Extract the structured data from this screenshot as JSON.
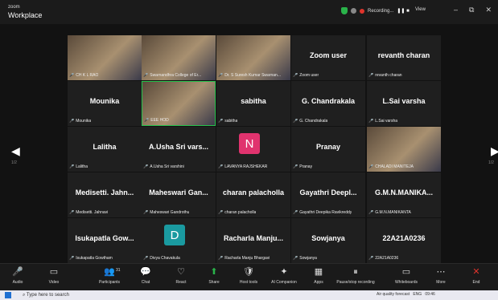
{
  "title": {
    "line1": "zoom",
    "line2": "Workplace"
  },
  "status": {
    "recording": "Recording...",
    "view": "View"
  },
  "window": {
    "min": "–",
    "max": "⧉",
    "close": "✕"
  },
  "nav": {
    "page_left": "1/2",
    "page_right": "1/2"
  },
  "tiles": [
    {
      "name": "",
      "label": "CH K L RAO",
      "video": true
    },
    {
      "name": "",
      "label": "Swarnandhra College of Er...",
      "video": true
    },
    {
      "name": "",
      "label": "Dr. S Suresh Kumar Swarnan...",
      "video": true
    },
    {
      "name": "Zoom user",
      "label": "Zoom user"
    },
    {
      "name": "revanth charan",
      "label": "revanth charan"
    },
    {
      "name": "Mounika",
      "label": "Mounika"
    },
    {
      "name": "",
      "label": "EEE HOD",
      "video": true,
      "active": true
    },
    {
      "name": "sabitha",
      "label": "sabitha"
    },
    {
      "name": "G. Chandrakala",
      "label": "G. Chandrakala"
    },
    {
      "name": "L.Sai varsha",
      "label": "L.Sai varsha"
    },
    {
      "name": "Lalitha",
      "label": "Lalitha"
    },
    {
      "name": "A.Usha Sri vars...",
      "label": "A.Usha Sri varshini"
    },
    {
      "name": "",
      "label": "LAVANYA RAJSHEKAR",
      "avatar": "N",
      "avatar_color": "#e0336e"
    },
    {
      "name": "Pranay",
      "label": "Pranay"
    },
    {
      "name": "",
      "label": "CHALADI MANITEJA",
      "video": true
    },
    {
      "name": "Medisetti. Jahn...",
      "label": "Medisetti. Jahnavi"
    },
    {
      "name": "Maheswari Gan...",
      "label": "Maheswari Gandrothu"
    },
    {
      "name": "charan palacholla",
      "label": "charan palacholla"
    },
    {
      "name": "Gayathri Deepl...",
      "label": "Gayathri Deepika Ravikreddy"
    },
    {
      "name": "G.M.N.MANIKA...",
      "label": "G.M.N.MANIKANTA"
    },
    {
      "name": "Isukapatla Gow...",
      "label": "Isukapatla Gowtham"
    },
    {
      "name": "",
      "label": "Divya Chavakula",
      "avatar": "D",
      "avatar_color": "#1a9aa0"
    },
    {
      "name": "Racharla Manju...",
      "label": "Racharla Manju Bhargavi"
    },
    {
      "name": "Sowjanya",
      "label": "Sowjanya"
    },
    {
      "name": "22A21A0236",
      "label": "22A21A0236"
    }
  ],
  "toolbar": [
    {
      "label": "Audio",
      "icon": "🎤"
    },
    {
      "label": "Video",
      "icon": "▭"
    },
    {
      "label": "Participants",
      "icon": "👥",
      "badge": "31"
    },
    {
      "label": "Chat",
      "icon": "💬"
    },
    {
      "label": "React",
      "icon": "♡"
    },
    {
      "label": "Share",
      "icon": "⬆"
    },
    {
      "label": "Host tools",
      "icon": "🛡"
    },
    {
      "label": "AI Companion",
      "icon": "✦"
    },
    {
      "label": "Apps",
      "icon": "▦"
    },
    {
      "label": "Pause/stop recording",
      "icon": "⏸"
    },
    {
      "label": "Whiteboards",
      "icon": "▭"
    },
    {
      "label": "More",
      "icon": "⋯"
    },
    {
      "label": "End",
      "icon": "✕"
    }
  ],
  "taskbar": {
    "search": "Type here to search",
    "weather": "Air quality forecast",
    "lang": "ENG",
    "time": "09:46"
  }
}
